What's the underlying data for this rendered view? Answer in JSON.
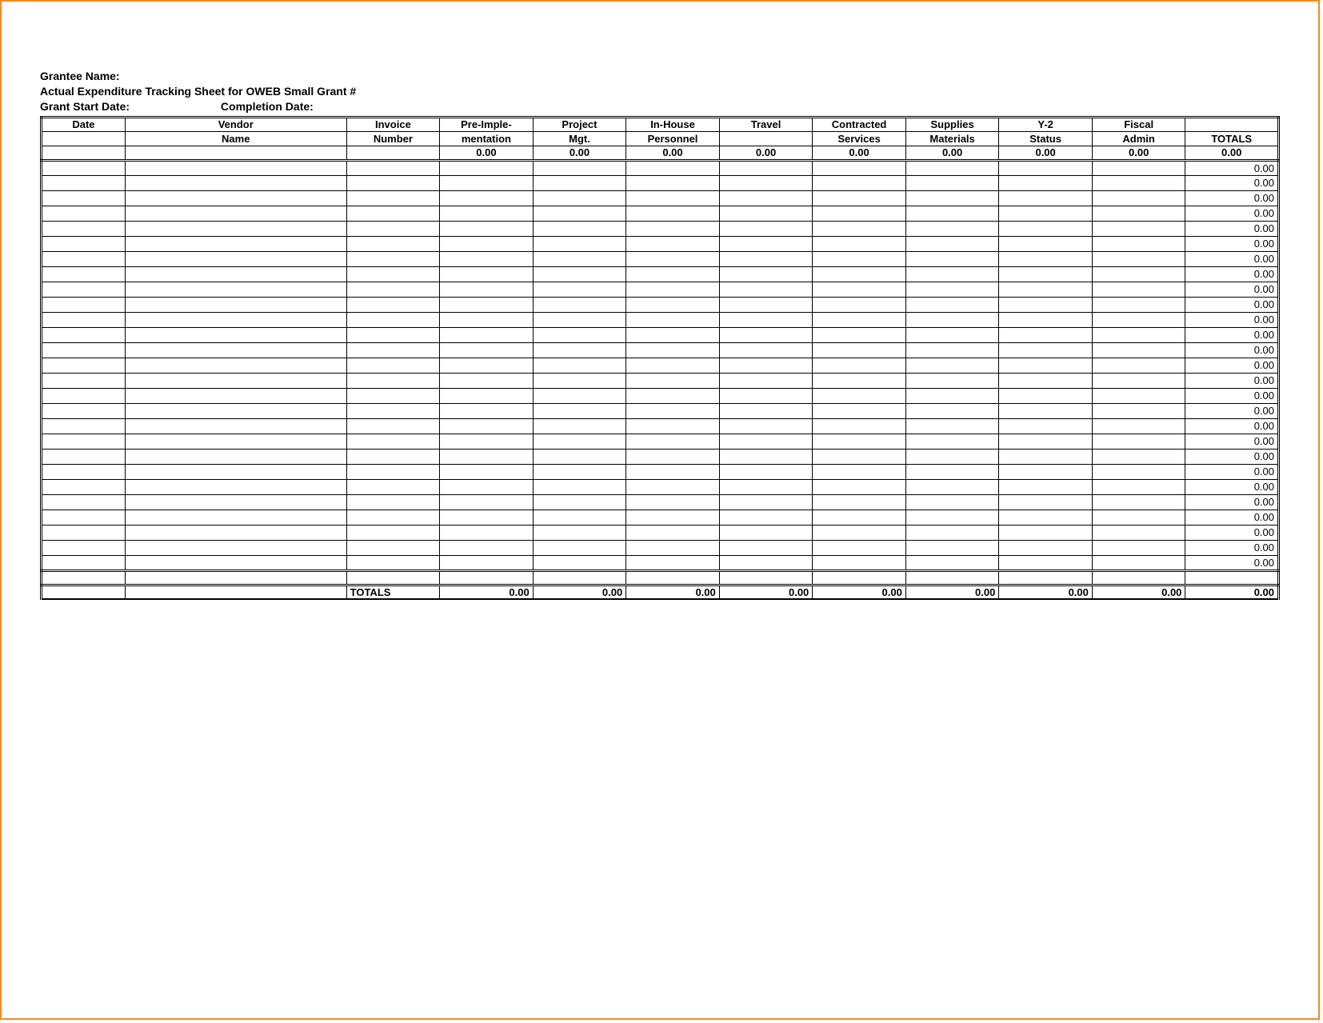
{
  "header": {
    "grantee_label": "Grantee Name:",
    "title": "Actual Expenditure Tracking Sheet for OWEB Small Grant #",
    "start_label": "Grant Start Date:",
    "completion_label": "Completion Date:"
  },
  "columns": {
    "r1": [
      "Date",
      "Vendor",
      "Invoice",
      "Pre-Imple-",
      "Project",
      "In-House",
      "Travel",
      "Contracted",
      "Supplies",
      "Y-2",
      "Fiscal",
      ""
    ],
    "r2": [
      "",
      "Name",
      "Number",
      "mentation",
      "Mgt.",
      "Personnel",
      "",
      "Services",
      "Materials",
      "Status",
      "Admin",
      "TOTALS"
    ],
    "subtotal": [
      "",
      "",
      "",
      "0.00",
      "0.00",
      "0.00",
      "0.00",
      "0.00",
      "0.00",
      "0.00",
      "0.00",
      "0.00"
    ]
  },
  "row_count": 27,
  "row_total": "0.00",
  "footer": {
    "label": "TOTALS",
    "values": [
      "0.00",
      "0.00",
      "0.00",
      "0.00",
      "0.00",
      "0.00",
      "0.00",
      "0.00",
      "0.00"
    ]
  }
}
